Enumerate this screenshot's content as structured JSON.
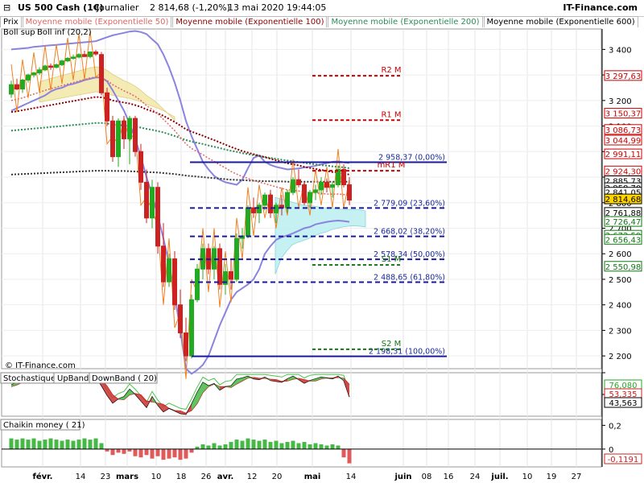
{
  "header": {
    "title": "US 500 Cash (1€)",
    "period": "Journalier",
    "quote": "2 814,68 (-1,20%)",
    "datetime": "13 mai 2020 19:44:05",
    "source": "IT-Finance.com"
  },
  "indicator_tabs": [
    {
      "label": "Prix",
      "color": "#000000"
    },
    {
      "label": "Moyenne mobile (Exponentielle 50)",
      "color": "#e06666"
    },
    {
      "label": "Moyenne mobile (Exponentielle 100)",
      "color": "#8b0000"
    },
    {
      "label": "Moyenne mobile (Exponentielle 200)",
      "color": "#2e8b57"
    },
    {
      "label": "Moyenne mobile (Exponentielle 600)",
      "color": "#000000"
    }
  ],
  "overlay_labels": {
    "boll_sup": "Boll sup",
    "boll_inf": "Boll inf (20,2)"
  },
  "watermark": "© IT-Finance.com",
  "colors": {
    "up": "#22aa22",
    "down": "#cc2222",
    "bollinger": "#8a84e0",
    "ema50": "#e06666",
    "ema100": "#8b0000",
    "ema200": "#2e8b57",
    "ema600": "#333333",
    "fib": "#1a1a9a",
    "orange": "#f08020",
    "cloud_cyan": "#bff0f2",
    "cloud_yellow": "#f3e8a8"
  },
  "chart_data": [
    {
      "type": "candlestick",
      "title": "US 500 Cash (1€)",
      "ylim": [
        2150,
        3480
      ],
      "x_ticks": [
        "févr.",
        "14",
        "23",
        "mars",
        "10",
        "18",
        "26",
        "avr.",
        "12",
        "20",
        "mai",
        "14",
        "juin",
        "08",
        "16",
        "24",
        "juil.",
        "10",
        "19",
        "27"
      ],
      "y_ticks": [
        3400,
        3300,
        3200,
        3100,
        3000,
        2900,
        2800,
        2700,
        2600,
        2500,
        2400,
        2300,
        2200
      ],
      "price_boxes": [
        {
          "label": "3 297,63",
          "value": 3297.63,
          "color": "#cc0000"
        },
        {
          "label": "3 150,37",
          "value": 3150.37,
          "color": "#cc0000"
        },
        {
          "label": "3 086,73",
          "value": 3086.73,
          "color": "#cc0000"
        },
        {
          "label": "3 044,99",
          "value": 3044.99,
          "color": "#cc0000"
        },
        {
          "label": "2 991,11",
          "value": 2991.11,
          "color": "#cc0000"
        },
        {
          "label": "2 924,30",
          "value": 2924.3,
          "color": "#cc0000"
        },
        {
          "label": "2 885,73",
          "value": 2885.73,
          "color": "#000000"
        },
        {
          "label": "2 858,70",
          "value": 2858.7,
          "color": "#000000"
        },
        {
          "label": "2 841,05",
          "value": 2841.05,
          "color": "#000000"
        },
        {
          "label": "2 814,68",
          "value": 2814.68,
          "color": "#000000",
          "highlight": true
        },
        {
          "label": "2 761,88",
          "value": 2761.88,
          "color": "#000000"
        },
        {
          "label": "2 726,47",
          "value": 2726.47,
          "color": "#117711"
        },
        {
          "label": "2 672,59",
          "value": 2672.59,
          "color": "#117711"
        },
        {
          "label": "2 656,43",
          "value": 2656.43,
          "color": "#117711"
        },
        {
          "label": "2 550,98",
          "value": 2550.98,
          "color": "#117711"
        }
      ],
      "fibonacci": [
        {
          "label": "2 958,37 (0,00%)",
          "value": 2958.37
        },
        {
          "label": "2 779,09 (23,60%)",
          "value": 2779.09
        },
        {
          "label": "2 668,02 (38,20%)",
          "value": 2668.02
        },
        {
          "label": "2 578,34 (50,00%)",
          "value": 2578.34
        },
        {
          "label": "2 488,65 (61,80%)",
          "value": 2488.65
        },
        {
          "label": "2 198,31 (100,00%)",
          "value": 2198.31
        }
      ],
      "pivots": [
        {
          "label": "R2 M",
          "value": 3297,
          "color": "#cc0000"
        },
        {
          "label": "R1 M",
          "value": 3123,
          "color": "#cc0000"
        },
        {
          "label": "mR1 M",
          "value": 2925,
          "color": "#cc0000"
        },
        {
          "label": "S1 M",
          "value": 2556,
          "color": "#117711"
        },
        {
          "label": "S2 M",
          "value": 2226,
          "color": "#117711"
        }
      ],
      "candles": [
        [
          3225,
          3278,
          3210,
          3262
        ],
        [
          3262,
          3285,
          3240,
          3245
        ],
        [
          3245,
          3285,
          3230,
          3280
        ],
        [
          3280,
          3305,
          3270,
          3300
        ],
        [
          3300,
          3312,
          3290,
          3308
        ],
        [
          3308,
          3330,
          3300,
          3320
        ],
        [
          3320,
          3340,
          3315,
          3335
        ],
        [
          3335,
          3345,
          3320,
          3330
        ],
        [
          3330,
          3345,
          3325,
          3340
        ],
        [
          3340,
          3360,
          3335,
          3355
        ],
        [
          3355,
          3370,
          3350,
          3365
        ],
        [
          3365,
          3380,
          3360,
          3370
        ],
        [
          3370,
          3385,
          3365,
          3380
        ],
        [
          3380,
          3395,
          3370,
          3372
        ],
        [
          3372,
          3393,
          3365,
          3390
        ],
        [
          3390,
          3398,
          3375,
          3382
        ],
        [
          3380,
          3390,
          3220,
          3230
        ],
        [
          3230,
          3250,
          3100,
          3120
        ],
        [
          3120,
          3140,
          2960,
          2980
        ],
        [
          2980,
          3130,
          2940,
          3120
        ],
        [
          3120,
          3140,
          3010,
          3050
        ],
        [
          3050,
          3140,
          2950,
          3130
        ],
        [
          3130,
          3140,
          2980,
          3000
        ],
        [
          3000,
          3030,
          2850,
          2880
        ],
        [
          2880,
          2930,
          2720,
          2740
        ],
        [
          2740,
          2890,
          2700,
          2860
        ],
        [
          2860,
          2880,
          2600,
          2630
        ],
        [
          2630,
          2720,
          2470,
          2490
        ],
        [
          2490,
          2600,
          2470,
          2580
        ],
        [
          2580,
          2610,
          2380,
          2400
        ],
        [
          2400,
          2460,
          2270,
          2290
        ],
        [
          2290,
          2350,
          2180,
          2200
        ],
        [
          2200,
          2440,
          2190,
          2420
        ],
        [
          2420,
          2560,
          2410,
          2540
        ],
        [
          2540,
          2640,
          2500,
          2620
        ],
        [
          2620,
          2640,
          2520,
          2540
        ],
        [
          2540,
          2630,
          2500,
          2620
        ],
        [
          2620,
          2640,
          2460,
          2480
        ],
        [
          2480,
          2560,
          2440,
          2530
        ],
        [
          2530,
          2580,
          2460,
          2500
        ],
        [
          2500,
          2680,
          2490,
          2660
        ],
        [
          2660,
          2700,
          2620,
          2670
        ],
        [
          2670,
          2790,
          2660,
          2780
        ],
        [
          2780,
          2820,
          2740,
          2760
        ],
        [
          2760,
          2800,
          2720,
          2790
        ],
        [
          2790,
          2840,
          2770,
          2830
        ],
        [
          2830,
          2850,
          2740,
          2760
        ],
        [
          2760,
          2800,
          2720,
          2790
        ],
        [
          2790,
          2830,
          2750,
          2780
        ],
        [
          2780,
          2850,
          2760,
          2840
        ],
        [
          2840,
          2900,
          2830,
          2890
        ],
        [
          2890,
          2930,
          2860,
          2870
        ],
        [
          2870,
          2880,
          2790,
          2800
        ],
        [
          2800,
          2850,
          2780,
          2840
        ],
        [
          2840,
          2870,
          2810,
          2850
        ],
        [
          2850,
          2900,
          2830,
          2880
        ],
        [
          2880,
          2895,
          2840,
          2860
        ],
        [
          2860,
          2880,
          2820,
          2870
        ],
        [
          2870,
          2945,
          2860,
          2930
        ],
        [
          2930,
          2950,
          2860,
          2870
        ],
        [
          2870,
          2900,
          2790,
          2810
        ]
      ],
      "bollinger_upper": [
        3400,
        3402,
        3404,
        3406,
        3410,
        3412,
        3414,
        3416,
        3418,
        3420,
        3422,
        3424,
        3426,
        3428,
        3430,
        3432,
        3440,
        3448,
        3455,
        3460,
        3465,
        3470,
        3472,
        3468,
        3460,
        3440,
        3420,
        3380,
        3330,
        3270,
        3200,
        3120,
        3060,
        3010,
        2960,
        2930,
        2905,
        2890,
        2880,
        2875,
        2870,
        2890,
        2935,
        2975,
        2985,
        2960,
        2948,
        2940,
        2935,
        2930,
        2932,
        2934,
        2938,
        2940,
        2945,
        2950,
        2955,
        2960,
        2962,
        2958,
        2955
      ],
      "bollinger_lower": [
        3160,
        3170,
        3180,
        3190,
        3200,
        3210,
        3220,
        3235,
        3245,
        3250,
        3260,
        3265,
        3272,
        3280,
        3285,
        3290,
        3290,
        3275,
        3240,
        3200,
        3160,
        3110,
        3050,
        2980,
        2900,
        2830,
        2750,
        2660,
        2560,
        2440,
        2300,
        2150,
        2130,
        2145,
        2165,
        2200,
        2260,
        2320,
        2370,
        2420,
        2450,
        2465,
        2480,
        2500,
        2540,
        2600,
        2630,
        2655,
        2665,
        2672,
        2680,
        2690,
        2700,
        2705,
        2715,
        2720,
        2725,
        2728,
        2730,
        2728,
        2725
      ],
      "ema50": [
        3200,
        3205,
        3210,
        3218,
        3225,
        3232,
        3240,
        3246,
        3252,
        3258,
        3264,
        3270,
        3276,
        3282,
        3288,
        3292,
        3288,
        3278,
        3262,
        3250,
        3238,
        3228,
        3216,
        3200,
        3180,
        3165,
        3148,
        3126,
        3105,
        3082,
        3056,
        3030,
        3012,
        3000,
        2988,
        2974,
        2962,
        2948,
        2936,
        2922,
        2912,
        2902,
        2895,
        2887,
        2880,
        2875,
        2868,
        2862,
        2856,
        2850,
        2848,
        2846,
        2842,
        2840,
        2838,
        2836,
        2834,
        2833,
        2834,
        2832,
        2828
      ],
      "ema100": [
        3155,
        3158,
        3162,
        3166,
        3170,
        3174,
        3178,
        3182,
        3186,
        3190,
        3194,
        3198,
        3202,
        3206,
        3210,
        3214,
        3212,
        3208,
        3200,
        3196,
        3192,
        3188,
        3182,
        3175,
        3165,
        3158,
        3150,
        3140,
        3128,
        3116,
        3102,
        3087,
        3078,
        3070,
        3062,
        3053,
        3045,
        3036,
        3027,
        3018,
        3010,
        3002,
        2996,
        2990,
        2984,
        2978,
        2972,
        2966,
        2960,
        2954,
        2950,
        2946,
        2940,
        2936,
        2932,
        2928,
        2924,
        2920,
        2918,
        2915,
        2910
      ],
      "ema200": [
        3082,
        3084,
        3086,
        3088,
        3090,
        3092,
        3094,
        3096,
        3098,
        3100,
        3102,
        3104,
        3106,
        3108,
        3110,
        3112,
        3112,
        3110,
        3106,
        3104,
        3102,
        3100,
        3097,
        3094,
        3089,
        3085,
        3080,
        3075,
        3068,
        3061,
        3053,
        3045,
        3039,
        3034,
        3030,
        3024,
        3019,
        3014,
        3008,
        3003,
        2999,
        2994,
        2990,
        2986,
        2983,
        2979,
        2975,
        2972,
        2968,
        2965,
        2962,
        2959,
        2956,
        2953,
        2950,
        2947,
        2945,
        2942,
        2940,
        2938,
        2935
      ],
      "ema600": [
        2910,
        2911,
        2912,
        2913,
        2914,
        2915,
        2916,
        2917,
        2918,
        2919,
        2920,
        2921,
        2922,
        2923,
        2924,
        2925,
        2925,
        2925,
        2924,
        2924,
        2924,
        2923,
        2922,
        2921,
        2920,
        2919,
        2918,
        2916,
        2914,
        2912,
        2909,
        2906,
        2904,
        2902,
        2900,
        2898,
        2896,
        2894,
        2892,
        2890,
        2889,
        2888,
        2887,
        2886,
        2885,
        2884,
        2884,
        2883,
        2883,
        2882,
        2882,
        2882,
        2882,
        2882,
        2882,
        2882,
        2882,
        2882,
        2882,
        2882,
        2882
      ]
    },
    {
      "type": "line",
      "title": "Stochastique",
      "legend": [
        "UpBand",
        "DownBand ( 20)"
      ],
      "ylim": [
        0,
        100
      ],
      "value_boxes": [
        {
          "label": "76,080",
          "value": 76.08,
          "color": "#22aa22"
        },
        {
          "label": "53,335",
          "value": 53.335,
          "color": "#cc2222"
        },
        {
          "label": "43,563",
          "value": 43.563,
          "color": "#000000"
        }
      ],
      "k": [
        72,
        78,
        85,
        88,
        90,
        92,
        93,
        92,
        91,
        92,
        93,
        94,
        95,
        94,
        92,
        90,
        70,
        48,
        30,
        40,
        45,
        62,
        50,
        35,
        20,
        45,
        25,
        10,
        18,
        12,
        6,
        4,
        28,
        55,
        78,
        70,
        75,
        60,
        68,
        70,
        85,
        88,
        92,
        86,
        84,
        90,
        82,
        80,
        78,
        86,
        92,
        84,
        76,
        82,
        86,
        90,
        88,
        86,
        92,
        82,
        44
      ],
      "d": [
        68,
        72,
        78,
        84,
        88,
        90,
        92,
        92,
        92,
        92,
        92,
        93,
        94,
        94,
        94,
        92,
        84,
        69,
        49,
        39,
        38,
        49,
        52,
        49,
        35,
        33,
        30,
        27,
        18,
        13,
        12,
        7,
        13,
        29,
        54,
        68,
        74,
        68,
        68,
        66,
        74,
        81,
        88,
        89,
        87,
        87,
        85,
        84,
        80,
        81,
        85,
        87,
        84,
        81,
        81,
        86,
        88,
        88,
        89,
        87,
        73
      ]
    },
    {
      "type": "bar",
      "title": "Chaikin money ( 21)",
      "ylim": [
        -0.15,
        0.25
      ],
      "y_ticks": [
        0.2,
        0
      ],
      "value_boxes": [
        {
          "label": "-0,1191",
          "value": -0.1191,
          "color": "#cc2222"
        }
      ],
      "values": [
        0.09,
        0.08,
        0.09,
        0.08,
        0.09,
        0.07,
        0.08,
        0.09,
        0.08,
        0.07,
        0.08,
        0.07,
        0.08,
        0.09,
        0.08,
        0.09,
        0.05,
        -0.02,
        -0.05,
        -0.03,
        -0.04,
        -0.02,
        -0.06,
        -0.07,
        -0.05,
        -0.08,
        -0.06,
        -0.09,
        -0.08,
        -0.07,
        -0.09,
        -0.08,
        -0.03,
        0.02,
        0.04,
        0.03,
        0.05,
        0.03,
        0.04,
        0.06,
        0.08,
        0.07,
        0.09,
        0.08,
        0.07,
        0.08,
        0.06,
        0.07,
        0.05,
        0.06,
        0.07,
        0.05,
        0.06,
        0.04,
        0.05,
        0.04,
        0.03,
        0.04,
        0.03,
        -0.07,
        -0.12
      ]
    }
  ]
}
